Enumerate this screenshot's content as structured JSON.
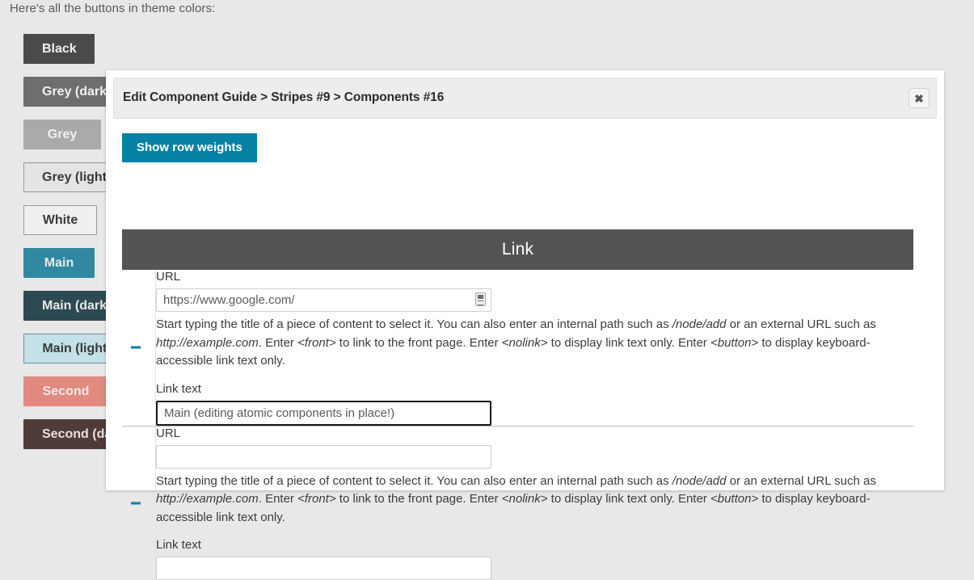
{
  "background": {
    "intro_text": "Here's all the buttons in theme colors:",
    "buttons": [
      {
        "label": "Black",
        "bg": "#4a4a4a",
        "fg": "#f0f0f0",
        "border": "#4a4a4a",
        "width": 88
      },
      {
        "label": "Grey (dark)",
        "bg": "#6e6e6e",
        "fg": "#f0f0f0",
        "border": "#6e6e6e",
        "width": 128
      },
      {
        "label": "Grey",
        "bg": "#aaaaaa",
        "fg": "#f0f0f0",
        "border": "#aaaaaa",
        "width": 96
      },
      {
        "label": "Grey (light)",
        "bg": "#e4e4e4",
        "fg": "#3a3a3a",
        "border": "#9a9a9a",
        "width": 129
      },
      {
        "label": "White",
        "bg": "#efefef",
        "fg": "#3a3a3a",
        "border": "#9a9a9a",
        "width": 91
      },
      {
        "label": "Main",
        "bg": "#3089a0",
        "fg": "#e8e8e8",
        "border": "#3089a0",
        "width": 80
      },
      {
        "label": "Main (dark)",
        "bg": "#2d4a52",
        "fg": "#e8e8e8",
        "border": "#2d4a52",
        "width": 128
      },
      {
        "label": "Main (light)",
        "bg": "#c4e1e8",
        "fg": "#3a3a3a",
        "border": "#6f8e96",
        "width": 132
      },
      {
        "label": "Second",
        "bg": "#e08a80",
        "fg": "#f0e8e8",
        "border": "#e08a80",
        "width": 105
      },
      {
        "label": "Second (dark)",
        "bg": "#4f3b38",
        "fg": "#e8e0e0",
        "border": "#4f3b38",
        "width": 140
      }
    ]
  },
  "modal": {
    "title": "Edit Component Guide > Stripes #9 > Components #16",
    "close_icon": "close-icon",
    "close_glyph": "✖",
    "show_row_weights_label": "Show row weights",
    "table": {
      "caption": "Link",
      "drag_handle_icon": "drag-handle-icon",
      "rows": [
        {
          "url_label": "URL",
          "url_value": "https://www.google.com/",
          "url_has_throbber": true,
          "url_description_parts": [
            {
              "text": "Start typing the title of a piece of content to select it. You can also enter an internal path such as ",
              "italic": false
            },
            {
              "text": "/node/add",
              "italic": true
            },
            {
              "text": " or an external URL such as ",
              "italic": false
            },
            {
              "text": "http://example.com",
              "italic": true
            },
            {
              "text": ". Enter ",
              "italic": false
            },
            {
              "text": "<front>",
              "italic": true
            },
            {
              "text": " to link to the front page. Enter ",
              "italic": false
            },
            {
              "text": "<nolink>",
              "italic": true
            },
            {
              "text": " to display link text only. Enter ",
              "italic": false
            },
            {
              "text": "<button>",
              "italic": true
            },
            {
              "text": " to display keyboard-accessible link text only.",
              "italic": false
            }
          ],
          "link_text_label": "Link text",
          "link_text_value": "Main (editing atomic components in place!)",
          "link_text_focused": true
        },
        {
          "url_label": "URL",
          "url_value": "",
          "url_has_throbber": false,
          "url_description_parts": [
            {
              "text": "Start typing the title of a piece of content to select it. You can also enter an internal path such as ",
              "italic": false
            },
            {
              "text": "/node/add",
              "italic": true
            },
            {
              "text": " or an external URL such as ",
              "italic": false
            },
            {
              "text": "http://example.com",
              "italic": true
            },
            {
              "text": ". Enter ",
              "italic": false
            },
            {
              "text": "<front>",
              "italic": true
            },
            {
              "text": " to link to the front page. Enter ",
              "italic": false
            },
            {
              "text": "<nolink>",
              "italic": true
            },
            {
              "text": " to display link text only. Enter ",
              "italic": false
            },
            {
              "text": "<button>",
              "italic": true
            },
            {
              "text": " to display keyboard-accessible link text only.",
              "italic": false
            }
          ],
          "link_text_label": "Link text",
          "link_text_value": "",
          "link_text_focused": false
        }
      ]
    }
  },
  "colors": {
    "accent": "#0481a5",
    "table_header": "#545454",
    "page_bg": "#e8e8e8",
    "modal_bg": "#ffffff"
  }
}
